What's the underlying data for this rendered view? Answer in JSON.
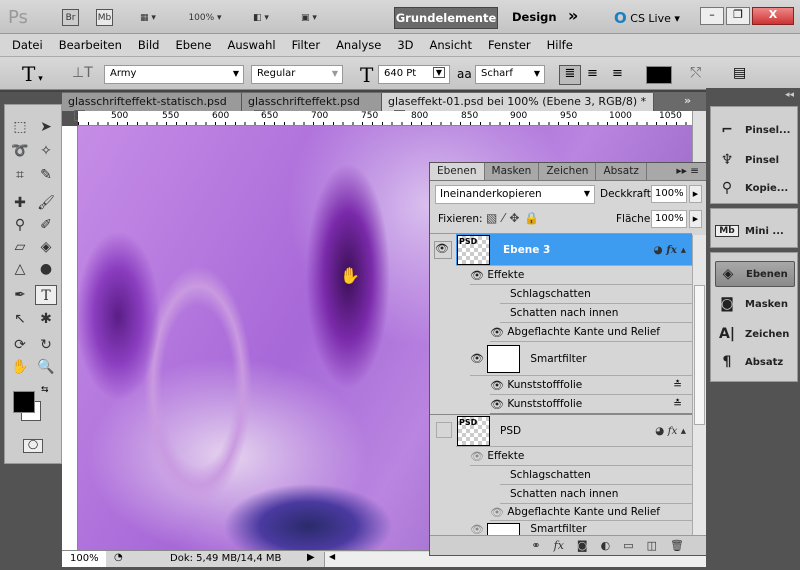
{
  "titlebar": {
    "logo": "Ps",
    "bridge": "Br",
    "minibridge": "Mb",
    "zoom": "100%",
    "workspace_active": "Grundelemente",
    "workspace_design": "Design",
    "more": "»",
    "cslive": "CS Live",
    "win_min": "–",
    "win_max": "❐",
    "win_close": "X"
  },
  "menu": [
    "Datei",
    "Bearbeiten",
    "Bild",
    "Ebene",
    "Auswahl",
    "Filter",
    "Analyse",
    "3D",
    "Ansicht",
    "Fenster",
    "Hilfe"
  ],
  "options": {
    "tool_icon": "T",
    "font_family": "Army",
    "font_style": "Regular",
    "font_size": "640 Pt",
    "aa_label": "aa",
    "antialias": "Scharf"
  },
  "tabs": [
    {
      "label": "glasschrifteffekt-statisch.psd",
      "active": false
    },
    {
      "label": "glasschrifteffekt.psd",
      "active": false
    },
    {
      "label": "glaseffekt-01.psd bei 100% (Ebene 3, RGB/8) *",
      "active": true
    }
  ],
  "ruler": [
    "500",
    "550",
    "600",
    "650",
    "700",
    "750",
    "800",
    "850",
    "900",
    "950",
    "1000",
    "1050"
  ],
  "status": {
    "zoom": "100%",
    "doc": "Dok: 5,49 MB/14,4 MB"
  },
  "dock": {
    "items": [
      "Pinsel...",
      "Pinsel",
      "Kopie...",
      "Mini ...",
      "Ebenen",
      "Masken",
      "Zeichen",
      "Absatz"
    ]
  },
  "layers_panel": {
    "tabs": [
      "Ebenen",
      "Masken",
      "Zeichen",
      "Absatz"
    ],
    "blend_mode": "Ineinanderkopieren",
    "opacity_label": "Deckkraft:",
    "opacity": "100%",
    "lock_label": "Fixieren:",
    "fill_label": "Fläche:",
    "fill": "100%",
    "layer1": {
      "name": "Ebene 3",
      "effects": "Effekte",
      "e1": "Schlagschatten",
      "e2": "Schatten nach innen",
      "e3": "Abgeflachte Kante und Relief",
      "smart": "Smartfilter",
      "f1": "Kunststofffolie",
      "f2": "Kunststofffolie"
    },
    "layer2": {
      "name": "PSD",
      "effects": "Effekte",
      "e1": "Schlagschatten",
      "e2": "Schatten nach innen",
      "e3": "Abgeflachte Kante und Relief",
      "smart": "Smartfilter"
    },
    "thumb_text": "PSD"
  },
  "colors": {
    "selected_layer": "#3d9bf0",
    "workspace_btn": "#6a6a6a"
  }
}
